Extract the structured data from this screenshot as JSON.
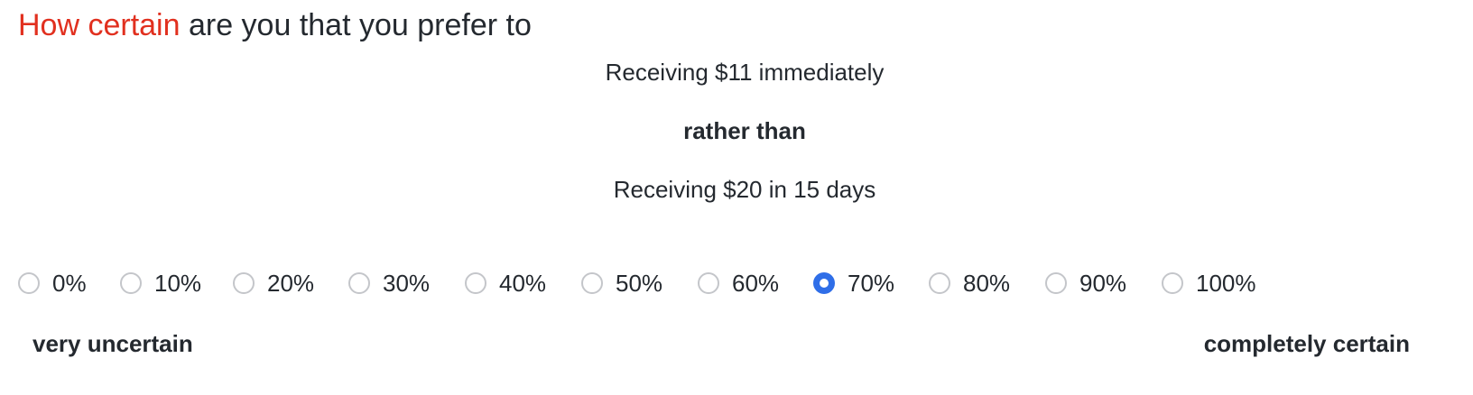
{
  "question": {
    "highlight": "How certain",
    "rest": " are you that you prefer to"
  },
  "choice": {
    "option_a": "Receiving $11 immediately",
    "connector": "rather than",
    "option_b": "Receiving $20 in 15 days"
  },
  "scale": {
    "options": [
      {
        "label": "0%",
        "checked": false
      },
      {
        "label": "10%",
        "checked": false
      },
      {
        "label": "20%",
        "checked": false
      },
      {
        "label": "30%",
        "checked": false
      },
      {
        "label": "40%",
        "checked": false
      },
      {
        "label": "50%",
        "checked": false
      },
      {
        "label": "60%",
        "checked": false
      },
      {
        "label": "70%",
        "checked": true
      },
      {
        "label": "80%",
        "checked": false
      },
      {
        "label": "90%",
        "checked": false
      },
      {
        "label": "100%",
        "checked": false
      }
    ],
    "selected": "70%",
    "left_anchor": "very uncertain",
    "right_anchor": "completely certain"
  },
  "colors": {
    "highlight": "#e1301f",
    "text": "#24292f",
    "radio_selected": "#2f6ee8",
    "radio_border": "#c4c6ca"
  }
}
